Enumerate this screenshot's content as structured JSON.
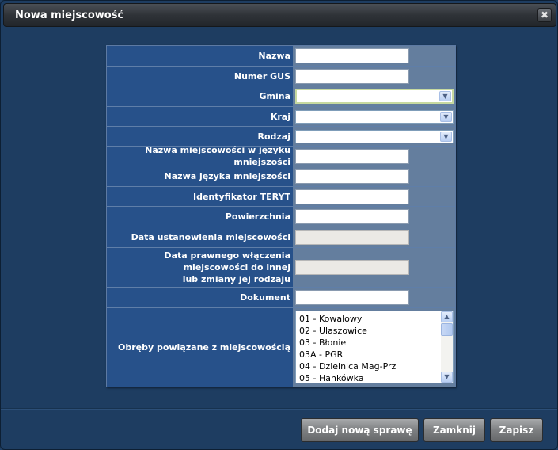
{
  "window": {
    "title": "Nowa miejscowość",
    "close_glyph": "✖"
  },
  "fields": {
    "nazwa": {
      "label": "Nazwa",
      "value": ""
    },
    "numer_gus": {
      "label": "Numer GUS",
      "value": ""
    },
    "gmina": {
      "label": "Gmina",
      "value": ""
    },
    "kraj": {
      "label": "Kraj",
      "value": ""
    },
    "rodzaj": {
      "label": "Rodzaj",
      "value": ""
    },
    "nazwa_mniejszosci": {
      "label": "Nazwa miejscowości w języku mniejszości",
      "value": ""
    },
    "nazwa_jezyka": {
      "label": "Nazwa języka mniejszości",
      "value": ""
    },
    "teryt": {
      "label": "Identyfikator TERYT",
      "value": ""
    },
    "powierzchnia": {
      "label": "Powierzchnia",
      "value": ""
    },
    "data_ustanowienia": {
      "label": "Data ustanowienia miejscowości",
      "value": ""
    },
    "data_wlaczenia": {
      "label_lines": [
        "Data prawnego włączenia",
        "miejscowości do innej",
        "lub zmiany jej rodzaju"
      ],
      "value": ""
    },
    "dokument": {
      "label": "Dokument",
      "value": ""
    },
    "obreby": {
      "label": "Obręby powiązane z miejscowością",
      "items": [
        "01 - Kowalowy",
        "02 - Ulaszowice",
        "03 - Błonie",
        "03A - PGR",
        "04 - Dzielnica Mag-Prz",
        "05 - Hankówka"
      ]
    }
  },
  "buttons": {
    "add_case": "Dodaj nową sprawę",
    "close": "Zamknij",
    "save": "Zapisz"
  },
  "icons": {
    "dropdown": "▼",
    "scroll_up": "▲",
    "scroll_down": "▼"
  }
}
